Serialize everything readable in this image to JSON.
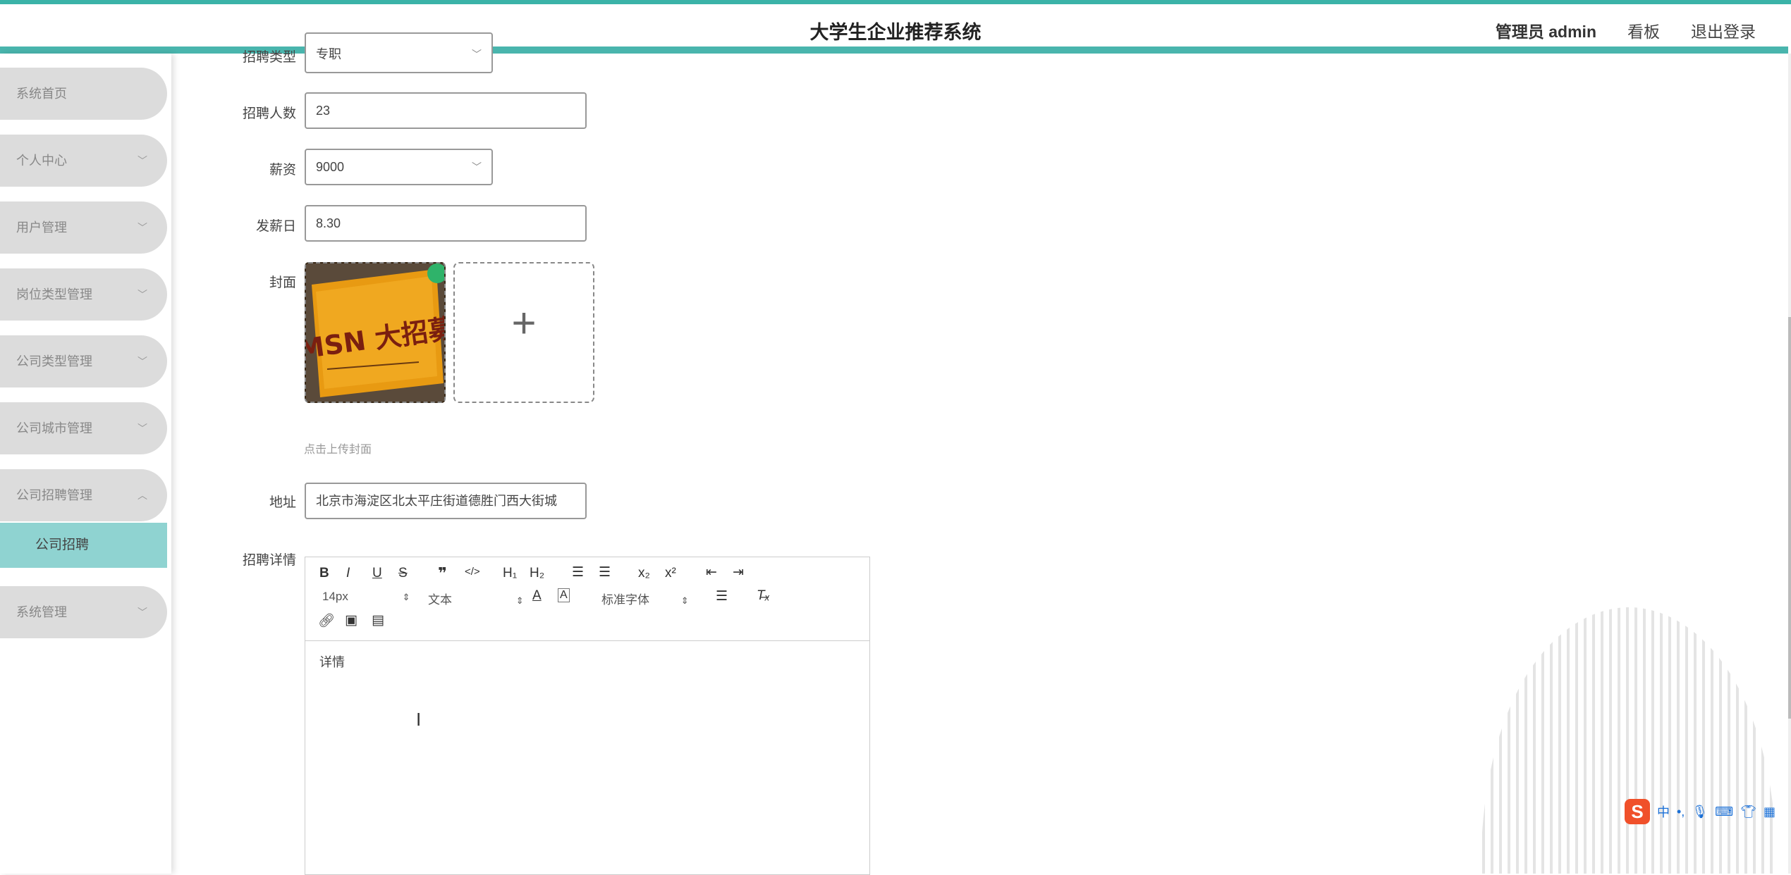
{
  "header": {
    "title": "大学生企业推荐系统",
    "admin": "管理员 admin",
    "board": "看板",
    "logout": "退出登录"
  },
  "sidebar": {
    "items": [
      {
        "label": "系统首页"
      },
      {
        "label": "个人中心"
      },
      {
        "label": "用户管理"
      },
      {
        "label": "岗位类型管理"
      },
      {
        "label": "公司类型管理"
      },
      {
        "label": "公司城市管理"
      },
      {
        "label": "公司招聘管理"
      },
      {
        "label": "系统管理"
      }
    ],
    "sub_item": "公司招聘"
  },
  "form": {
    "type_label": "招聘类型",
    "type_value": "专职",
    "count_label": "招聘人数",
    "count_value": "23",
    "salary_label": "薪资",
    "salary_value": "9000",
    "payday_label": "发薪日",
    "payday_value": "8.30",
    "cover_label": "封面",
    "cover_image_text": "MSN 大招募",
    "upload_tip": "点击上传封面",
    "address_label": "地址",
    "address_value": "北京市海淀区北太平庄街道德胜门西大街城",
    "detail_label": "招聘详情"
  },
  "editor": {
    "font_size": "14px",
    "block_type": "文本",
    "font_family": "标准字体",
    "content": "详情"
  },
  "ime": {
    "lang": "中"
  },
  "colors": {
    "accent": "#49b5ad",
    "submenu": "#8fd3d1",
    "menu_bg": "#dcdcdc"
  }
}
